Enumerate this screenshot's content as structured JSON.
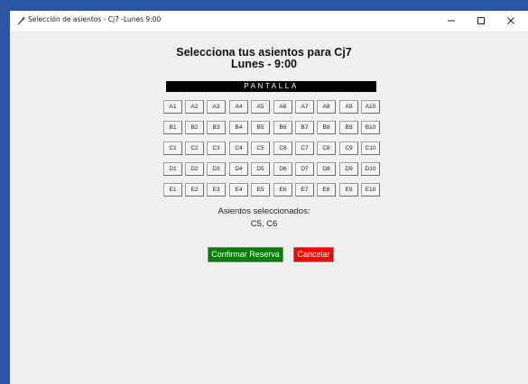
{
  "window": {
    "title": "Selección de asientos - Cj7 -Lunes 9:00",
    "icon": "feather-icon",
    "controls": [
      "minimize-icon",
      "maximize-icon",
      "close-icon"
    ]
  },
  "header": {
    "title": "Selecciona tus asientos para Cj7",
    "subtitle": "Lunes - 9:00"
  },
  "screen_label": "PANTALLA",
  "seats": [
    [
      "A1",
      "A2",
      "A3",
      "A4",
      "A5",
      "A6",
      "A7",
      "A8",
      "A9",
      "A10"
    ],
    [
      "B1",
      "B2",
      "B3",
      "B4",
      "B5",
      "B6",
      "B7",
      "B8",
      "B9",
      "B10"
    ],
    [
      "C1",
      "C2",
      "C3",
      "C4",
      "C5",
      "C6",
      "C7",
      "C8",
      "C9",
      "C10"
    ],
    [
      "D1",
      "D2",
      "D3",
      "D4",
      "D5",
      "D6",
      "D7",
      "D8",
      "D9",
      "D10"
    ],
    [
      "E1",
      "E2",
      "E3",
      "E4",
      "E5",
      "E6",
      "E7",
      "E8",
      "E9",
      "E10"
    ]
  ],
  "selection": {
    "label": "Asientos seleccionados:",
    "value": "C5, C6"
  },
  "buttons": {
    "confirm": "Confirmar Reserva",
    "cancel": "Cancelar"
  },
  "colors": {
    "confirm_bg": "#008000",
    "cancel_bg": "#ff0000",
    "screen_bg": "#000000",
    "desktop": "#2b56a8"
  }
}
